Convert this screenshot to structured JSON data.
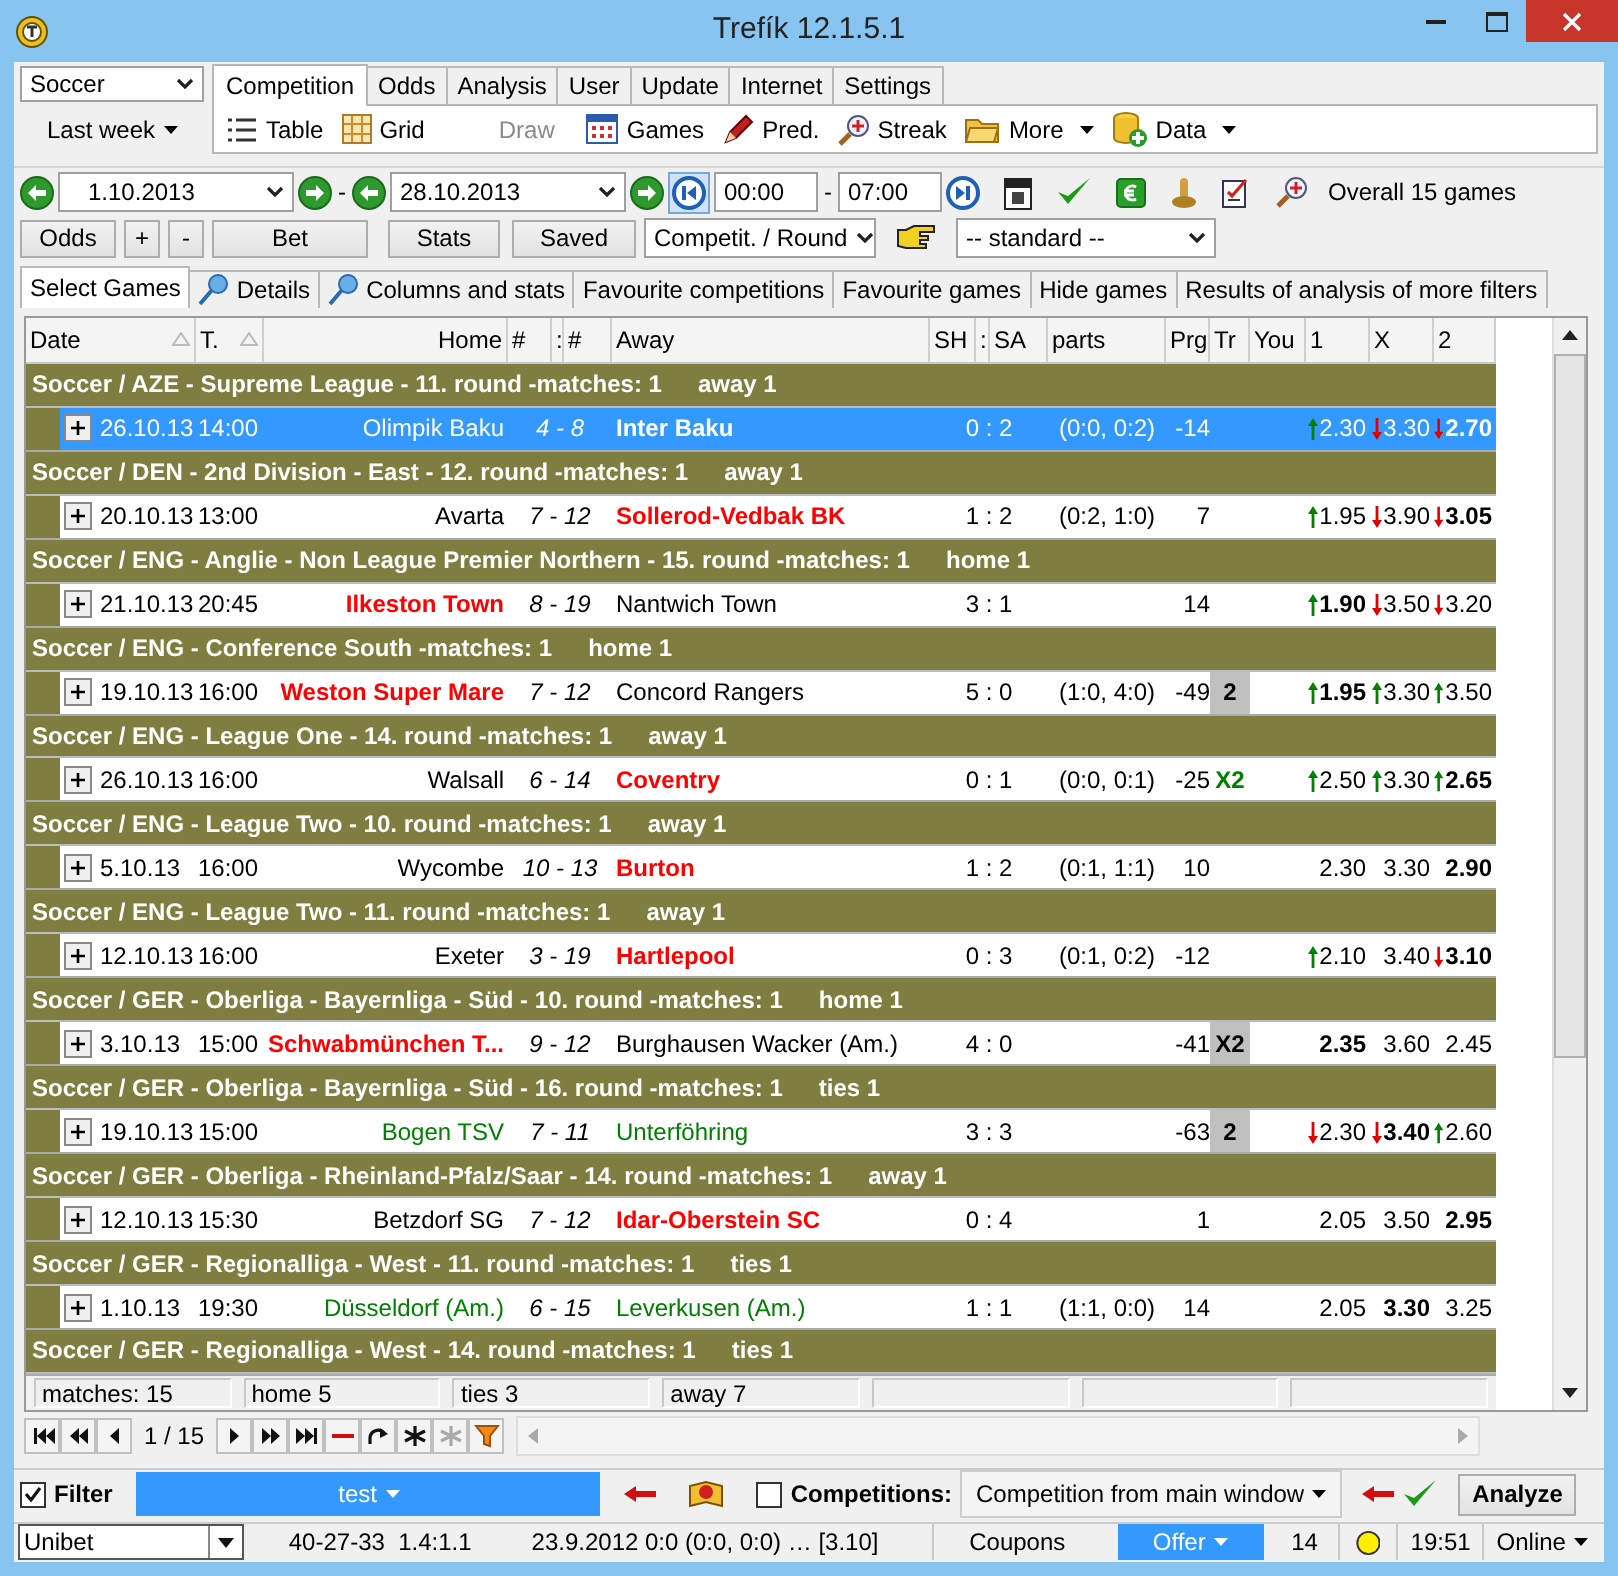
{
  "window": {
    "title": "Trefík 12.1.5.1"
  },
  "sport_select": {
    "value": "Soccer"
  },
  "period_button": {
    "label": "Last week"
  },
  "ribbon_tabs": [
    {
      "label": "Competition",
      "selected": true
    },
    {
      "label": "Odds",
      "selected": false
    },
    {
      "label": "Analysis",
      "selected": false
    },
    {
      "label": "User",
      "selected": false
    },
    {
      "label": "Update",
      "selected": false
    },
    {
      "label": "Internet",
      "selected": false
    },
    {
      "label": "Settings",
      "selected": false
    }
  ],
  "ribbon_tools": [
    {
      "label": "Table",
      "disabled": false,
      "dropdown": false
    },
    {
      "label": "Grid",
      "disabled": false,
      "dropdown": false
    },
    {
      "label": "Draw",
      "disabled": true,
      "dropdown": false
    },
    {
      "label": "Games",
      "disabled": false,
      "dropdown": false
    },
    {
      "label": "Pred.",
      "disabled": false,
      "dropdown": false
    },
    {
      "label": "Streak",
      "disabled": false,
      "dropdown": false
    },
    {
      "label": "More",
      "disabled": false,
      "dropdown": true
    },
    {
      "label": "Data",
      "disabled": false,
      "dropdown": true
    }
  ],
  "date_range": {
    "from": "1.10.2013",
    "sep1": "-",
    "to": "28.10.2013",
    "time_from": "00:00",
    "sep2": "-",
    "time_to": "07:00",
    "summary": "Overall 15 games"
  },
  "filter_buttons": [
    "Odds",
    "+",
    "-",
    "Bet",
    "Stats",
    "Saved"
  ],
  "group_select": {
    "value": "Competit. / Round"
  },
  "view_select": {
    "value": "-- standard --"
  },
  "view_tabs": [
    {
      "label": "Select Games",
      "selected": true
    },
    {
      "label": "Details",
      "selected": false
    },
    {
      "label": "Columns and stats",
      "selected": false
    },
    {
      "label": "Favourite competitions",
      "selected": false
    },
    {
      "label": "Favourite games",
      "selected": false
    },
    {
      "label": "Hide games",
      "selected": false
    },
    {
      "label": "Results of analysis of more filters",
      "selected": false
    }
  ],
  "table": {
    "columns": [
      "Date",
      "T.",
      "Home",
      "#",
      ":",
      "#",
      "Away",
      "SH",
      ":",
      "SA",
      "parts",
      "Prg",
      "Tr",
      "You",
      "1",
      "X",
      "2"
    ],
    "groups": [
      {
        "title": "Soccer / AZE - Supreme League - 11. round -matches: 1",
        "summary": "away 1",
        "match": {
          "selected": true,
          "date": "26.10.13",
          "time": "14:00",
          "home": "Olimpik Baku",
          "ranks": "4 - 8",
          "away": "Inter Baku",
          "home_win": false,
          "away_win": true,
          "tie": false,
          "score": "0 : 2",
          "parts": "(0:0, 0:2)",
          "prg": "-14",
          "odds": [
            {
              "value": "2.30",
              "kind": "up",
              "bold": false
            },
            {
              "value": "3.30",
              "kind": "down",
              "bold": false
            },
            {
              "value": "2.70",
              "kind": "down",
              "bold": true
            }
          ]
        }
      },
      {
        "title": "Soccer / DEN - 2nd Division - East - 12. round -matches: 1",
        "summary": "away 1",
        "match": {
          "selected": false,
          "date": "20.10.13",
          "time": "13:00",
          "home": "Avarta",
          "ranks": "7 - 12",
          "away": "Sollerod-Vedbak BK",
          "home_win": false,
          "away_win": true,
          "tie": false,
          "score": "1 : 2",
          "parts": "(0:2, 1:0)",
          "prg": "7",
          "odds": [
            {
              "value": "1.95",
              "kind": "up",
              "bold": false
            },
            {
              "value": "3.90",
              "kind": "down",
              "bold": false
            },
            {
              "value": "3.05",
              "kind": "down",
              "bold": true
            }
          ]
        }
      },
      {
        "title": "Soccer / ENG - Anglie - Non League Premier Northern - 15. round -matches: 1",
        "summary": "home 1",
        "match": {
          "selected": false,
          "date": "21.10.13",
          "time": "20:45",
          "home": "Ilkeston Town",
          "ranks": "8 - 19",
          "away": "Nantwich Town",
          "home_win": true,
          "away_win": false,
          "tie": false,
          "score": "3 : 1",
          "prg": "14",
          "odds": [
            {
              "value": "1.90",
              "kind": "up",
              "bold": true
            },
            {
              "value": "3.50",
              "kind": "down",
              "bold": false
            },
            {
              "value": "3.20",
              "kind": "down",
              "bold": false
            }
          ]
        }
      },
      {
        "title": "Soccer / ENG - Conference South -matches: 1",
        "summary": "home 1",
        "match": {
          "selected": false,
          "date": "19.10.13",
          "time": "16:00",
          "home": "Weston Super Mare",
          "ranks": "7 - 12",
          "away": "Concord Rangers",
          "home_win": true,
          "away_win": false,
          "tie": false,
          "score": "5 : 0",
          "parts": "(1:0, 4:0)",
          "prg": "-49",
          "tr": {
            "text": "2",
            "boxed": true
          },
          "odds": [
            {
              "value": "1.95",
              "kind": "up",
              "bold": true
            },
            {
              "value": "3.30",
              "kind": "up",
              "bold": false
            },
            {
              "value": "3.50",
              "kind": "up",
              "bold": false
            }
          ]
        }
      },
      {
        "title": "Soccer / ENG - League One - 14. round -matches: 1",
        "summary": "away 1",
        "match": {
          "selected": false,
          "date": "26.10.13",
          "time": "16:00",
          "home": "Walsall",
          "ranks": "6 - 14",
          "away": "Coventry",
          "home_win": false,
          "away_win": true,
          "tie": false,
          "score": "0 : 1",
          "parts": "(0:0, 0:1)",
          "prg": "-25",
          "tr": {
            "text": "X2",
            "boxed": false
          },
          "odds": [
            {
              "value": "2.50",
              "kind": "up",
              "bold": false
            },
            {
              "value": "3.30",
              "kind": "up",
              "bold": false
            },
            {
              "value": "2.65",
              "kind": "up",
              "bold": true
            }
          ]
        }
      },
      {
        "title": "Soccer / ENG - League Two - 10. round -matches: 1",
        "summary": "away 1",
        "match": {
          "selected": false,
          "date": "5.10.13",
          "time": "16:00",
          "home": "Wycombe",
          "ranks": "10 - 13",
          "away": "Burton",
          "home_win": false,
          "away_win": true,
          "tie": false,
          "score": "1 : 2",
          "parts": "(0:1, 1:1)",
          "prg": "10",
          "odds": [
            {
              "value": "2.30",
              "kind": "plain",
              "bold": false
            },
            {
              "value": "3.30",
              "kind": "plain",
              "bold": false
            },
            {
              "value": "2.90",
              "kind": "plain",
              "bold": true
            }
          ]
        }
      },
      {
        "title": "Soccer / ENG - League Two - 11. round -matches: 1",
        "summary": "away 1",
        "match": {
          "selected": false,
          "date": "12.10.13",
          "time": "16:00",
          "home": "Exeter",
          "ranks": "3 - 19",
          "away": "Hartlepool",
          "home_win": false,
          "away_win": true,
          "tie": false,
          "score": "0 : 3",
          "parts": "(0:1, 0:2)",
          "prg": "-12",
          "odds": [
            {
              "value": "2.10",
              "kind": "up",
              "bold": false
            },
            {
              "value": "3.40",
              "kind": "plain",
              "bold": false
            },
            {
              "value": "3.10",
              "kind": "down",
              "bold": true
            }
          ]
        }
      },
      {
        "title": "Soccer / GER - Oberliga - Bayernliga - Süd - 10. round -matches: 1",
        "summary": "home 1",
        "match": {
          "selected": false,
          "date": "3.10.13",
          "time": "15:00",
          "home": "Schwabmünchen T...",
          "ranks": "9 - 12",
          "away": "Burghausen Wacker (Am.)",
          "home_win": true,
          "away_win": false,
          "tie": false,
          "score": "4 : 0",
          "prg": "-41",
          "tr": {
            "text": "X2",
            "boxed": true
          },
          "odds": [
            {
              "value": "2.35",
              "kind": "plain",
              "bold": true
            },
            {
              "value": "3.60",
              "kind": "plain",
              "bold": false
            },
            {
              "value": "2.45",
              "kind": "plain",
              "bold": false
            }
          ]
        }
      },
      {
        "title": "Soccer / GER - Oberliga - Bayernliga - Süd - 16. round -matches: 1",
        "summary": "ties 1",
        "match": {
          "selected": false,
          "date": "19.10.13",
          "time": "15:00",
          "home": "Bogen TSV",
          "ranks": "7 - 11",
          "away": "Unterföhring",
          "home_win": false,
          "away_win": false,
          "tie": true,
          "score": "3 : 3",
          "prg": "-63",
          "tr": {
            "text": "2",
            "boxed": true
          },
          "odds": [
            {
              "value": "2.30",
              "kind": "down",
              "bold": false
            },
            {
              "value": "3.40",
              "kind": "down",
              "bold": true
            },
            {
              "value": "2.60",
              "kind": "up",
              "bold": false
            }
          ]
        }
      },
      {
        "title": "Soccer / GER - Oberliga - Rheinland-Pfalz/Saar - 14. round -matches: 1",
        "summary": "away 1",
        "match": {
          "selected": false,
          "date": "12.10.13",
          "time": "15:30",
          "home": "Betzdorf SG",
          "ranks": "7 - 12",
          "away": "Idar-Oberstein SC",
          "home_win": false,
          "away_win": true,
          "tie": false,
          "score": "0 : 4",
          "prg": "1",
          "odds": [
            {
              "value": "2.05",
              "kind": "plain",
              "bold": false
            },
            {
              "value": "3.50",
              "kind": "plain",
              "bold": false
            },
            {
              "value": "2.95",
              "kind": "plain",
              "bold": true
            }
          ]
        }
      },
      {
        "title": "Soccer / GER - Regionalliga - West - 11. round -matches: 1",
        "summary": "ties 1",
        "match": {
          "selected": false,
          "date": "1.10.13",
          "time": "19:30",
          "home": "Düsseldorf (Am.)",
          "ranks": "6 - 15",
          "away": "Leverkusen (Am.)",
          "home_win": false,
          "away_win": false,
          "tie": true,
          "score": "1 : 1",
          "parts": "(1:1, 0:0)",
          "prg": "14",
          "odds": [
            {
              "value": "2.05",
              "kind": "plain",
              "bold": false
            },
            {
              "value": "3.30",
              "kind": "plain",
              "bold": true
            },
            {
              "value": "3.25",
              "kind": "plain",
              "bold": false
            }
          ]
        }
      },
      {
        "title": "Soccer / GER - Regionalliga - West - 14. round -matches: 1",
        "summary": "ties 1"
      }
    ]
  },
  "summary_bar": [
    "matches: 15",
    "home 5",
    "ties 3",
    "away 7"
  ],
  "pager": {
    "position": "1 / 15"
  },
  "filter_bar": {
    "filter_checked": true,
    "filter_label": "Filter",
    "filter_value": "test",
    "competitions_checked": false,
    "competitions_label": "Competitions:",
    "competition_value": "Competition from main window",
    "analyze": "Analyze"
  },
  "status_bar": {
    "bookmaker": "Unibet",
    "stats": "40-27-33  1.4:1.1",
    "last": "23.9.2012 0:0 (0:0, 0:0) … [3.10]",
    "coupons": "Coupons",
    "offer": "Offer",
    "count": "14",
    "time": "19:51",
    "online": "Online"
  }
}
